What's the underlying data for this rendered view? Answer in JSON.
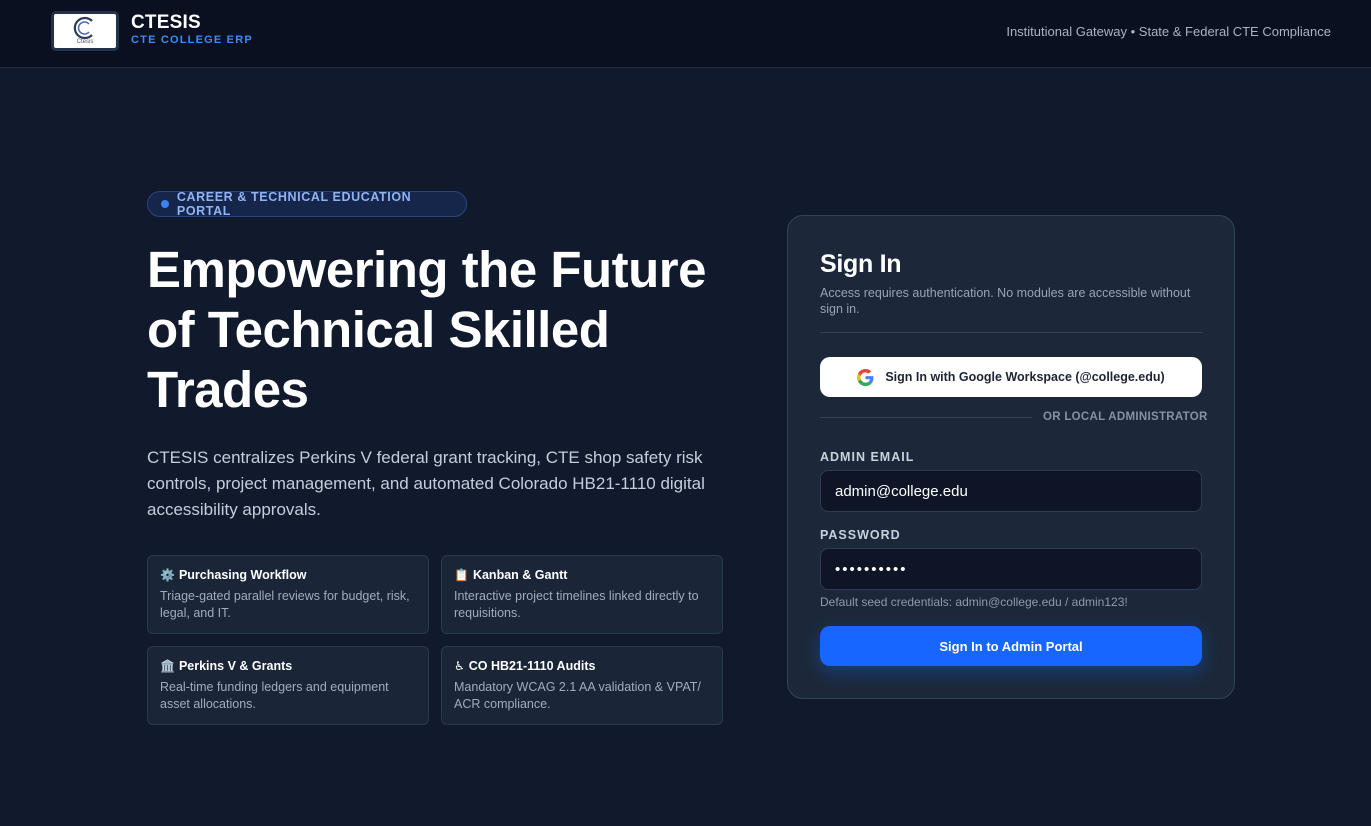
{
  "header": {
    "brand_name": "CTESIS",
    "brand_sub": "CTE COLLEGE ERP",
    "logo_small_text": "Ctesis",
    "right_text": "Institutional Gateway • State & Federal CTE Compliance"
  },
  "hero": {
    "pill_text": "CAREER & TECHNICAL EDUCATION PORTAL",
    "title": "Empowering the Future of Technical Skilled Trades",
    "description": "CTESIS centralizes Perkins V federal grant tracking, CTE shop safety risk controls, project management, and automated Colorado HB21-1110 digital accessibility approvals."
  },
  "features": [
    {
      "icon": "⚙️",
      "icon_name": "gear-icon",
      "title": "Purchasing Workflow",
      "desc": "Triage-gated parallel reviews for budget, risk, legal, and IT."
    },
    {
      "icon": "📋",
      "icon_name": "clipboard-icon",
      "title": "Kanban & Gantt",
      "desc": "Interactive project timelines linked directly to requisitions."
    },
    {
      "icon": "🏛️",
      "icon_name": "bank-icon",
      "title": "Perkins V & Grants",
      "desc": "Real-time funding ledgers and equipment asset allocations."
    },
    {
      "icon": "♿",
      "icon_name": "accessibility-icon",
      "title": "CO HB21-1110 Audits",
      "desc": "Mandatory WCAG 2.1 AA validation & VPAT/ ACR compliance."
    }
  ],
  "signin": {
    "title": "Sign In",
    "subtitle": "Access requires authentication. No modules are accessible without sign in.",
    "google_label": "Sign In with Google Workspace (@college.edu)",
    "or_text": "OR LOCAL ADMINISTRATOR",
    "email_label": "ADMIN EMAIL",
    "email_value": "admin@college.edu",
    "password_label": "PASSWORD",
    "password_value": "admin123!!",
    "hint": "Default seed credentials: admin@college.edu / admin123!",
    "submit_label": "Sign In to Admin Portal"
  },
  "colors": {
    "background": "#111a2c",
    "header": "#0a1020",
    "accent": "#1766ff",
    "brand_sub": "#3b8af5"
  }
}
